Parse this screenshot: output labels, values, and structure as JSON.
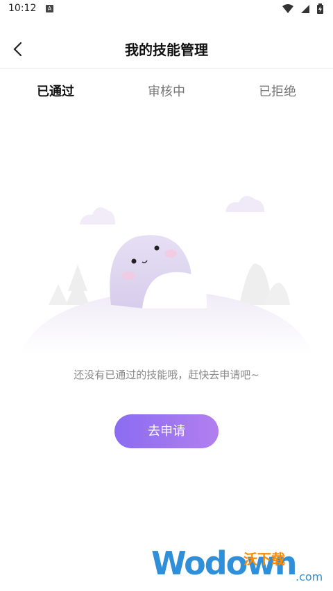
{
  "status": {
    "time": "10:12",
    "app_icon": "A"
  },
  "nav": {
    "title": "我的技能管理"
  },
  "tabs": [
    {
      "label": "已通过",
      "active": true
    },
    {
      "label": "审核中",
      "active": false
    },
    {
      "label": "已拒绝",
      "active": false
    }
  ],
  "empty_state": {
    "message": "还没有已通过的技能哦，赶快去申请吧~",
    "button_label": "去申请"
  },
  "watermark": {
    "main": "Wodown",
    "badge": "沃下载",
    "suffix": ".com"
  },
  "colors": {
    "accent_start": "#8b6cf2",
    "accent_end": "#b27fef",
    "watermark": "#2f8fd8"
  }
}
